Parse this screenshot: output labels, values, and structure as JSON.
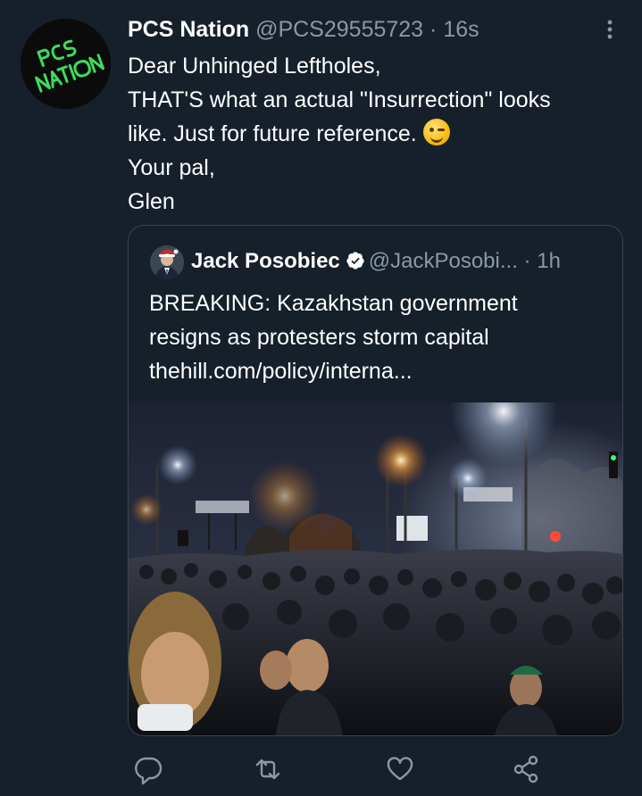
{
  "tweet": {
    "name": "PCS Nation",
    "handle": "@PCS29555723",
    "separator": "·",
    "time": "16s",
    "more_icon": "more-vertical-icon",
    "avatar_text": "PCS NATION",
    "lines": [
      "Dear Unhinged Leftholes,",
      "THAT'S what an actual \"Insurrection\" looks",
      "like. Just for future reference.",
      "Your pal,",
      "Glen"
    ],
    "emoji": "winking-face-emoji"
  },
  "quote": {
    "name": "Jack Posobiec",
    "verified_icon": "verified-badge-icon",
    "handle": "@JackPosobi...",
    "separator": "·",
    "time": "1h",
    "lines": [
      "BREAKING: Kazakhstan government",
      "resigns as protesters storm capital",
      "thehill.com/policy/interna..."
    ],
    "image": "night-crowd-protest-photo"
  },
  "actions": [
    {
      "name": "reply-icon"
    },
    {
      "name": "retweet-icon"
    },
    {
      "name": "like-icon"
    },
    {
      "name": "share-icon"
    }
  ],
  "colors": {
    "background": "#15202b",
    "secondary_text": "#8b98a5",
    "border": "#38444d",
    "logo_green": "#3ddc5a",
    "verified_blue": "#ffffff"
  }
}
